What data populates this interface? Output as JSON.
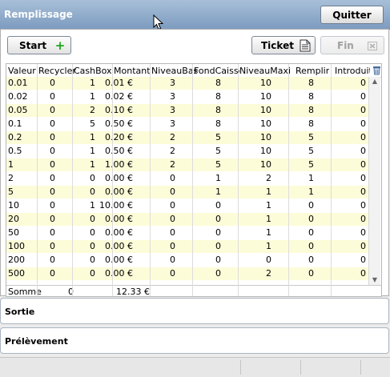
{
  "window": {
    "title": "Remplissage",
    "quit_label": "Quitter"
  },
  "toolbar": {
    "start_label": "Start",
    "ticket_label": "Ticket",
    "fin_label": "Fin",
    "icons": {
      "start": "plus-icon",
      "ticket": "ticket-icon",
      "fin": "close-icon"
    }
  },
  "grid": {
    "columns": [
      "Valeur",
      "Recycler",
      "CashBox",
      "Montant",
      "NiveauBas",
      "FondCaisse",
      "NiveauMaxi",
      "Remplir",
      "Introduit"
    ],
    "rows": [
      [
        "0.01",
        "0",
        "1",
        "0.01 €",
        "3",
        "8",
        "10",
        "8",
        "0"
      ],
      [
        "0.02",
        "0",
        "1",
        "0.02 €",
        "3",
        "8",
        "10",
        "8",
        "0"
      ],
      [
        "0.05",
        "0",
        "2",
        "0.10 €",
        "3",
        "8",
        "10",
        "8",
        "0"
      ],
      [
        "0.1",
        "0",
        "5",
        "0.50 €",
        "3",
        "8",
        "10",
        "8",
        "0"
      ],
      [
        "0.2",
        "0",
        "1",
        "0.20 €",
        "2",
        "5",
        "10",
        "5",
        "0"
      ],
      [
        "0.5",
        "0",
        "1",
        "0.50 €",
        "2",
        "5",
        "10",
        "5",
        "0"
      ],
      [
        "1",
        "0",
        "1",
        "1.00 €",
        "2",
        "5",
        "10",
        "5",
        "0"
      ],
      [
        "2",
        "0",
        "0",
        "0.00 €",
        "0",
        "1",
        "2",
        "1",
        "0"
      ],
      [
        "5",
        "0",
        "0",
        "0.00 €",
        "0",
        "1",
        "1",
        "1",
        "0"
      ],
      [
        "10",
        "0",
        "1",
        "10.00 €",
        "0",
        "0",
        "1",
        "0",
        "0"
      ],
      [
        "20",
        "0",
        "0",
        "0.00 €",
        "0",
        "0",
        "1",
        "0",
        "0"
      ],
      [
        "50",
        "0",
        "0",
        "0.00 €",
        "0",
        "0",
        "1",
        "0",
        "0"
      ],
      [
        "100",
        "0",
        "0",
        "0.00 €",
        "0",
        "0",
        "1",
        "0",
        "0"
      ],
      [
        "200",
        "0",
        "0",
        "0.00 €",
        "0",
        "0",
        "0",
        "0",
        "0"
      ],
      [
        "500",
        "0",
        "0",
        "0.00 €",
        "0",
        "0",
        "2",
        "0",
        "0"
      ]
    ],
    "summary": {
      "label": "Somme",
      "recycler": "0",
      "montant": "12.33 €"
    },
    "icons": {
      "column_chooser": "trash-icon",
      "scroll_up": "scroll-up-arrow",
      "scroll_down": "scroll-down-arrow"
    }
  },
  "sections": [
    {
      "title": "Sortie"
    },
    {
      "title": "Prélèvement"
    }
  ],
  "colors": {
    "title_bar": "#7d9cc0",
    "row_alt": "#fcfcd8"
  }
}
